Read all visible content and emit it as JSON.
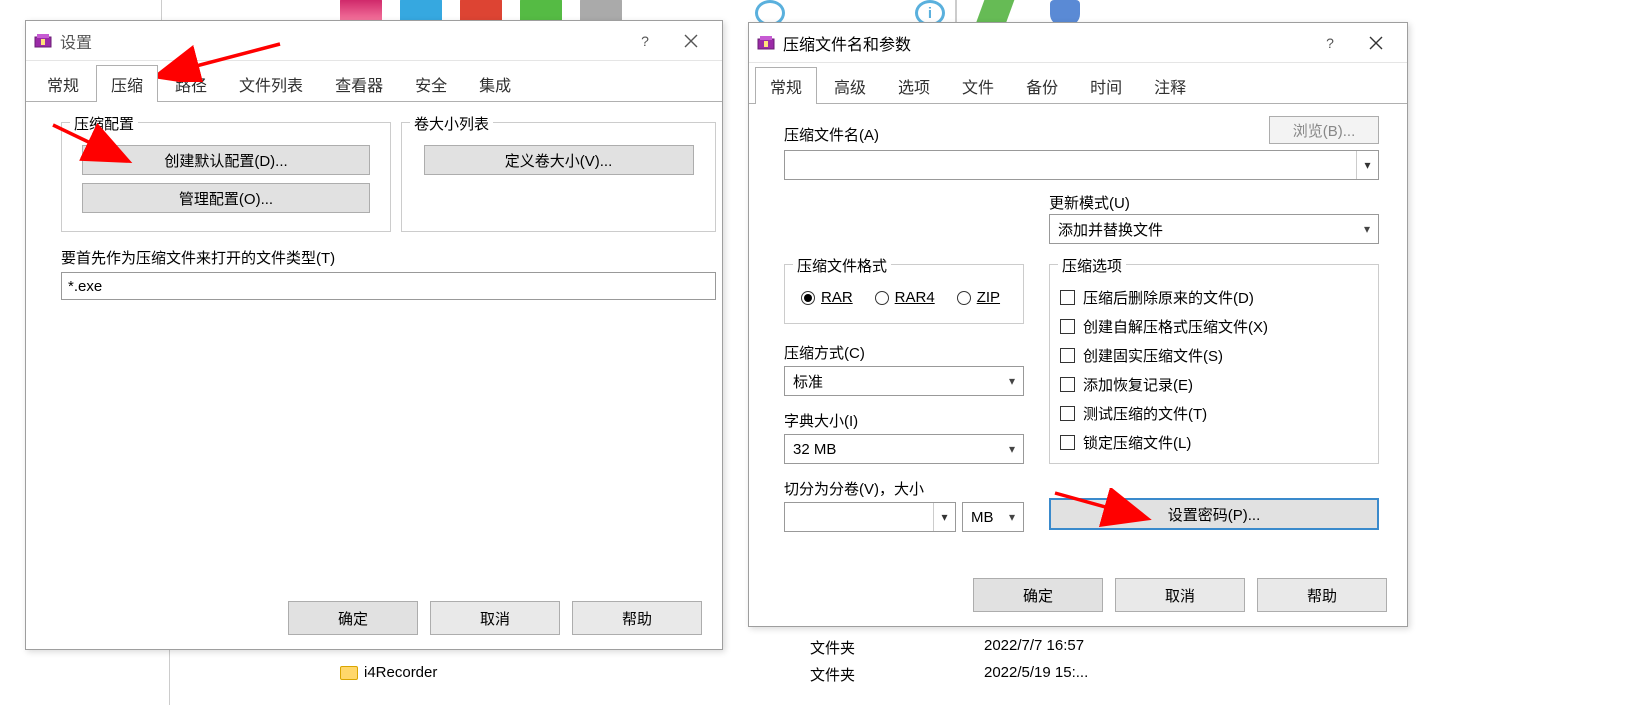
{
  "settings_dialog": {
    "title": "设置",
    "tabs": [
      "常规",
      "压缩",
      "路径",
      "文件列表",
      "查看器",
      "安全",
      "集成"
    ],
    "active_tab_index": 1,
    "compress_group_label": "压缩配置",
    "create_default_btn": "创建默认配置(D)...",
    "manage_config_btn": "管理配置(O)...",
    "volume_group_label": "卷大小列表",
    "define_volume_btn": "定义卷大小(V)...",
    "open_as_archive_label": "要首先作为压缩文件来打开的文件类型(T)",
    "open_as_archive_value": "*.exe",
    "ok": "确定",
    "cancel": "取消",
    "help": "帮助"
  },
  "archive_dialog": {
    "title": "压缩文件名和参数",
    "tabs": [
      "常规",
      "高级",
      "选项",
      "文件",
      "备份",
      "时间",
      "注释"
    ],
    "active_tab_index": 0,
    "archive_name_label": "压缩文件名(A)",
    "browse_btn": "浏览(B)...",
    "archive_name_value": "",
    "update_mode_label": "更新模式(U)",
    "update_mode_value": "添加并替换文件",
    "format_group_label": "压缩文件格式",
    "formats": [
      "RAR",
      "RAR4",
      "ZIP"
    ],
    "selected_format_index": 0,
    "method_label": "压缩方式(C)",
    "method_value": "标准",
    "dict_label": "字典大小(I)",
    "dict_value": "32 MB",
    "split_label": "切分为分卷(V)，大小",
    "split_value": "",
    "split_unit": "MB",
    "options_group_label": "压缩选项",
    "options": [
      "压缩后删除原来的文件(D)",
      "创建自解压格式压缩文件(X)",
      "创建固实压缩文件(S)",
      "添加恢复记录(E)",
      "测试压缩的文件(T)",
      "锁定压缩文件(L)"
    ],
    "set_password_btn": "设置密码(P)...",
    "ok": "确定",
    "cancel": "取消",
    "help": "帮助"
  },
  "file_rows": [
    {
      "name": "文件夹",
      "date": "2022/7/7 16:57"
    },
    {
      "name": "文件夹",
      "date": "2022/5/19 15:..."
    }
  ],
  "recorder_folder": "i4Recorder"
}
